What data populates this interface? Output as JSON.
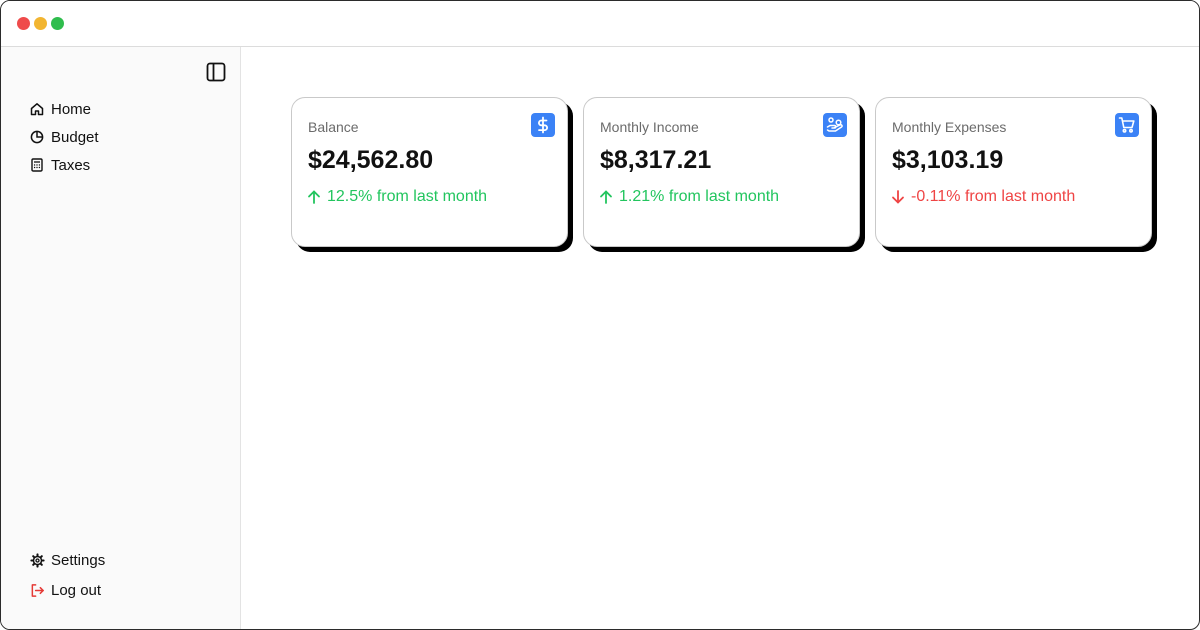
{
  "colors": {
    "accent": "#3b82f6",
    "positive": "#22c55e",
    "negative": "#ef4444",
    "logout": "#e53935"
  },
  "sidebar": {
    "toggle_icon": "sidebar-toggle-icon",
    "items": [
      {
        "label": "Home",
        "icon": "home-icon"
      },
      {
        "label": "Budget",
        "icon": "pie-chart-icon"
      },
      {
        "label": "Taxes",
        "icon": "calculator-icon"
      }
    ],
    "bottom_items": [
      {
        "label": "Settings",
        "icon": "gear-icon"
      },
      {
        "label": "Log out",
        "icon": "logout-icon"
      }
    ]
  },
  "cards": [
    {
      "label": "Balance",
      "value": "$24,562.80",
      "change": "12.5% from last month",
      "trend": "up",
      "icon": "dollar-icon"
    },
    {
      "label": "Monthly Income",
      "value": "$8,317.21",
      "change": "1.21% from last month",
      "trend": "up",
      "icon": "hand-coins-icon"
    },
    {
      "label": "Monthly Expenses",
      "value": "$3,103.19",
      "change": "-0.11% from last month",
      "trend": "down",
      "icon": "cart-icon"
    }
  ]
}
